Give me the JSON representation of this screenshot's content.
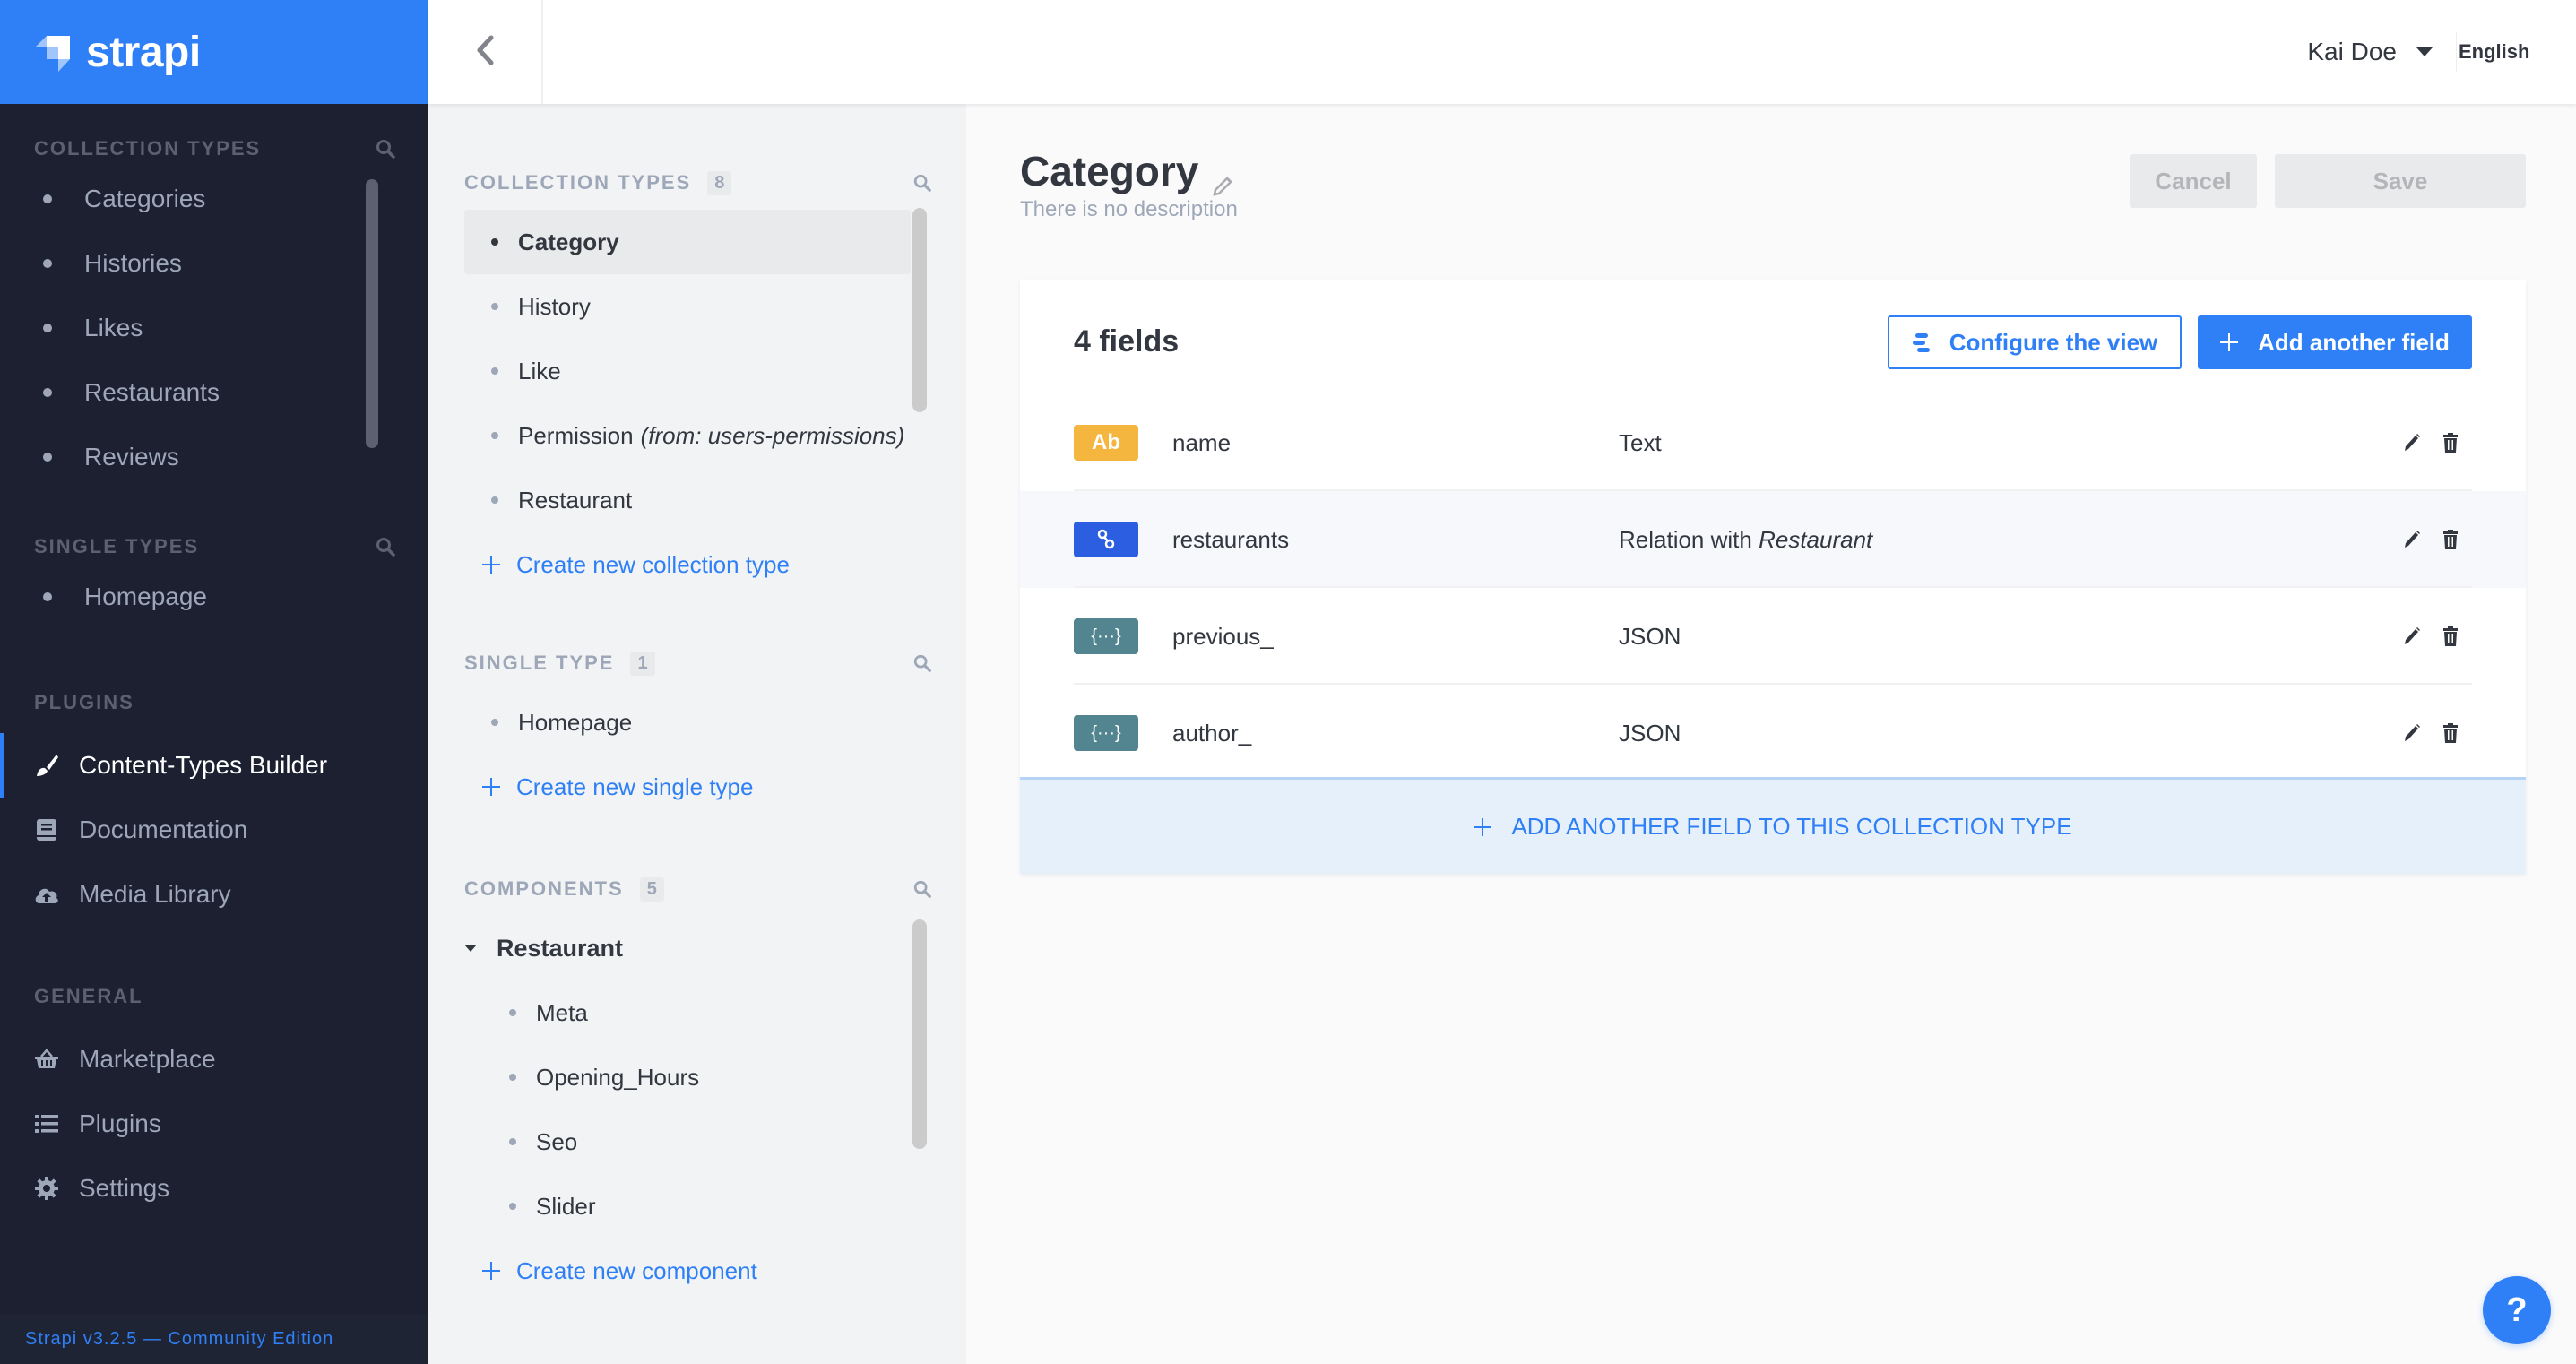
{
  "brand": {
    "name": "strapi",
    "color": "#2f80f6"
  },
  "leftnav": {
    "collection_types": {
      "heading": "COLLECTION TYPES",
      "items": [
        "Categories",
        "Histories",
        "Likes",
        "Restaurants",
        "Reviews"
      ]
    },
    "single_types": {
      "heading": "SINGLE TYPES",
      "items": [
        "Homepage"
      ]
    },
    "plugins": {
      "heading": "PLUGINS",
      "items": [
        {
          "label": "Content-Types Builder",
          "icon": "paint-brush-icon",
          "active": true
        },
        {
          "label": "Documentation",
          "icon": "book-icon"
        },
        {
          "label": "Media Library",
          "icon": "cloud-upload-icon"
        }
      ]
    },
    "general": {
      "heading": "GENERAL",
      "items": [
        {
          "label": "Marketplace",
          "icon": "basket-icon"
        },
        {
          "label": "Plugins",
          "icon": "list-icon"
        },
        {
          "label": "Settings",
          "icon": "gear-icon"
        }
      ]
    },
    "footer": "Strapi v3.2.5 — Community Edition"
  },
  "header": {
    "user": "Kai Doe",
    "language": "English"
  },
  "subnav": {
    "collection_types": {
      "heading": "COLLECTION TYPES",
      "count": "8",
      "items": [
        {
          "label": "Category",
          "active": true
        },
        {
          "label": "History"
        },
        {
          "label": "Like"
        },
        {
          "label": "Permission",
          "suffix": "(from: users-permissions)"
        },
        {
          "label": "Restaurant"
        }
      ],
      "create": "Create new collection type"
    },
    "single_type": {
      "heading": "SINGLE TYPE",
      "count": "1",
      "items": [
        {
          "label": "Homepage"
        }
      ],
      "create": "Create new single type"
    },
    "components": {
      "heading": "COMPONENTS",
      "count": "5",
      "group": "Restaurant",
      "items": [
        "Meta",
        "Opening_Hours",
        "Seo",
        "Slider"
      ],
      "create": "Create new component"
    }
  },
  "main": {
    "title": "Category",
    "description": "There is no description",
    "cancel": "Cancel",
    "save": "Save",
    "fields_count": "4 fields",
    "configure_view": "Configure the view",
    "add_field": "Add another field",
    "fields": [
      {
        "name": "name",
        "type": "Text",
        "badge": "Ab",
        "badge_color": "#f5b63f",
        "icon": "text-icon"
      },
      {
        "name": "restaurants",
        "type": "Relation with",
        "type_em": "Restaurant",
        "badge": "",
        "badge_color": "#2c5ee2",
        "icon": "link-icon"
      },
      {
        "name": "previous_",
        "type": "JSON",
        "badge": "{···}",
        "badge_color": "#52858f",
        "icon": "json-icon"
      },
      {
        "name": "author_",
        "type": "JSON",
        "badge": "{···}",
        "badge_color": "#52858f",
        "icon": "json-icon"
      }
    ],
    "add_bar": "ADD ANOTHER FIELD TO THIS COLLECTION TYPE",
    "help": "?"
  }
}
